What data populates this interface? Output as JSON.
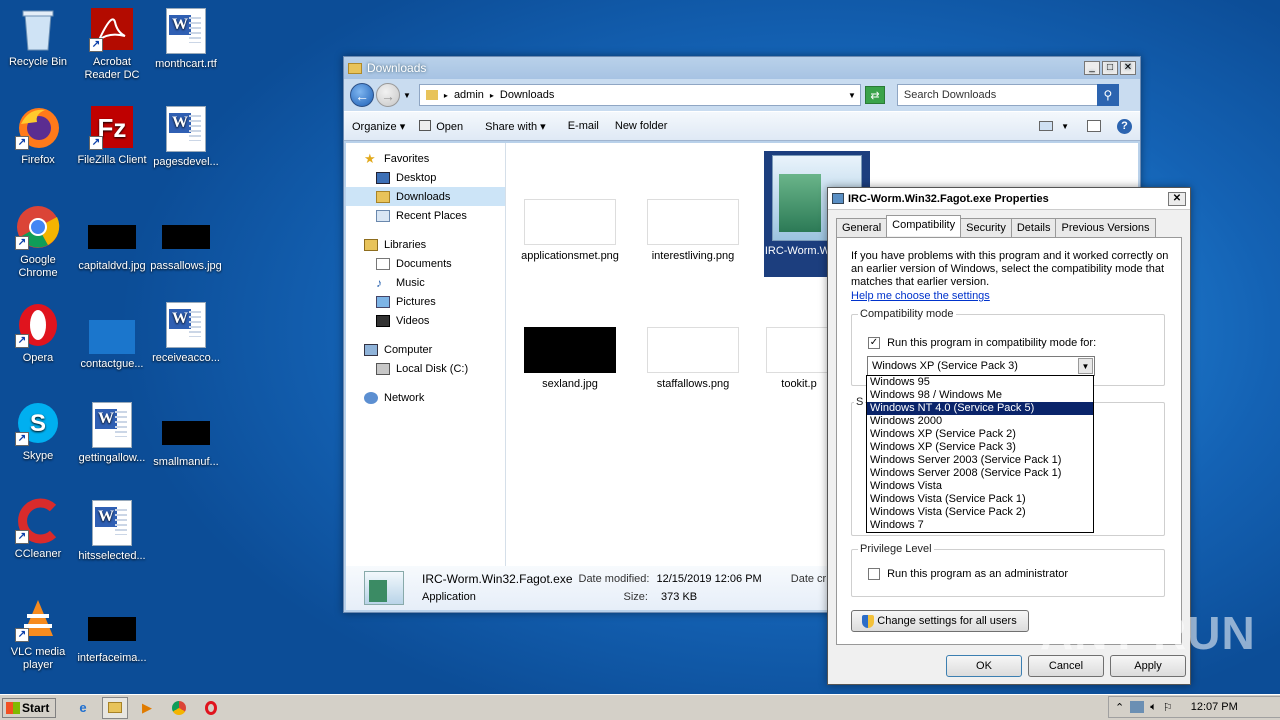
{
  "desktop": {
    "icons": [
      {
        "label": "Recycle Bin"
      },
      {
        "label": "Acrobat Reader DC"
      },
      {
        "label": "monthcart.rtf"
      },
      {
        "label": "Firefox"
      },
      {
        "label": "FileZilla Client"
      },
      {
        "label": "pagesdevel..."
      },
      {
        "label": "Google Chrome"
      },
      {
        "label": "capitaldvd.jpg"
      },
      {
        "label": "passallows.jpg"
      },
      {
        "label": "Opera"
      },
      {
        "label": "contactgue..."
      },
      {
        "label": "receiveacco..."
      },
      {
        "label": "Skype"
      },
      {
        "label": "gettingallow..."
      },
      {
        "label": "smallmanuf..."
      },
      {
        "label": "CCleaner"
      },
      {
        "label": "hitsselected..."
      },
      {
        "label": "VLC media player"
      },
      {
        "label": "interfaceima..."
      }
    ]
  },
  "explorer": {
    "title": "Downloads",
    "breadcrumb": [
      "admin",
      "Downloads"
    ],
    "search_placeholder": "Search Downloads",
    "toolbar": {
      "organize": "Organize",
      "open": "Open",
      "share_with": "Share with",
      "email": "E-mail",
      "new_folder": "New folder"
    },
    "nav": {
      "favorites": "Favorites",
      "desktop": "Desktop",
      "downloads": "Downloads",
      "recent": "Recent Places",
      "libraries": "Libraries",
      "documents": "Documents",
      "music": "Music",
      "pictures": "Pictures",
      "videos": "Videos",
      "computer": "Computer",
      "local_disk": "Local Disk (C:)",
      "network": "Network"
    },
    "files": [
      {
        "name": "applicationsmet.png"
      },
      {
        "name": "interestliving.png"
      },
      {
        "name": "IRC-Worm.W...agot.e"
      },
      {
        "name": "sexland.jpg"
      },
      {
        "name": "staffallows.png"
      },
      {
        "name": "tookit.p"
      }
    ],
    "status": {
      "file_name": "IRC-Worm.Win32.Fagot.exe",
      "date_modified_label": "Date modified:",
      "date_modified": "12/15/2019 12:06 PM",
      "date_created_label": "Date cr",
      "type": "Application",
      "size_label": "Size:",
      "size": "373 KB"
    }
  },
  "props": {
    "title": "IRC-Worm.Win32.Fagot.exe Properties",
    "tabs": [
      "General",
      "Compatibility",
      "Security",
      "Details",
      "Previous Versions"
    ],
    "intro": "If you have problems with this program and it worked correctly on an earlier version of Windows, select the compatibility mode that matches that earlier version.",
    "help_link": "Help me choose the settings",
    "compat_group": "Compatibility mode",
    "compat_check": "Run this program in compatibility mode for:",
    "compat_selected": "Windows XP (Service Pack 3)",
    "settings_group_initial": "S",
    "options": [
      "Windows 95",
      "Windows 98 / Windows Me",
      "Windows NT 4.0 (Service Pack 5)",
      "Windows 2000",
      "Windows XP (Service Pack 2)",
      "Windows XP (Service Pack 3)",
      "Windows Server 2003 (Service Pack 1)",
      "Windows Server 2008 (Service Pack 1)",
      "Windows Vista",
      "Windows Vista (Service Pack 1)",
      "Windows Vista (Service Pack 2)",
      "Windows 7"
    ],
    "highlighted_option": "Windows NT 4.0 (Service Pack 5)",
    "privilege_group": "Privilege Level",
    "admin_check": "Run this program as an administrator",
    "change_all": "Change settings for all users",
    "ok": "OK",
    "cancel": "Cancel",
    "apply": "Apply"
  },
  "taskbar": {
    "start": "Start",
    "clock": "12:07 PM"
  },
  "watermark": "ANY RUN"
}
